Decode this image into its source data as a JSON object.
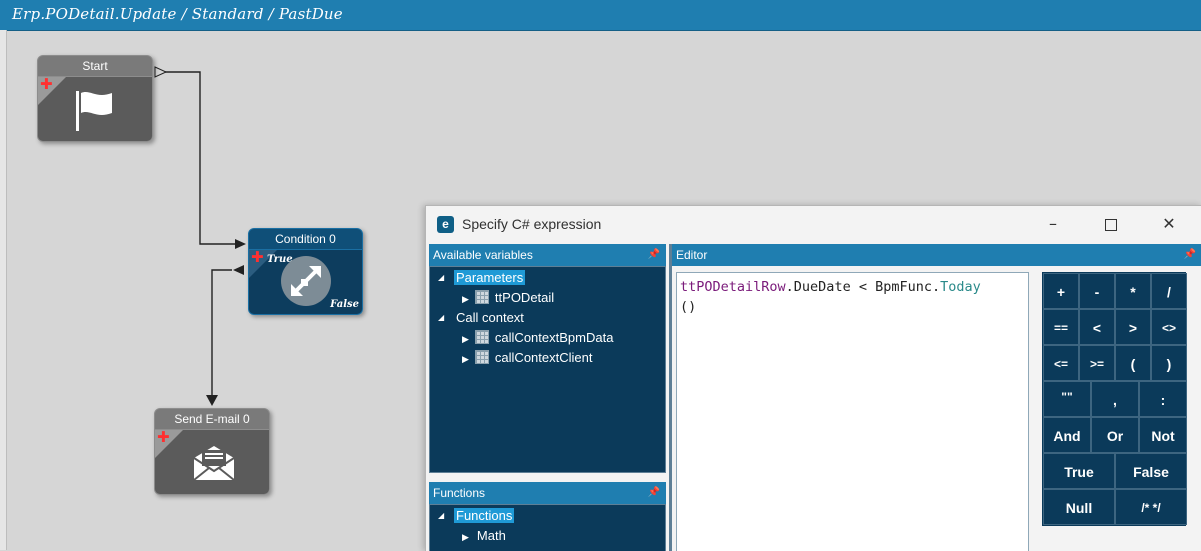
{
  "header": {
    "title": "Erp.PODetail.Update / Standard / PastDue"
  },
  "nodes": {
    "start": {
      "label": "Start",
      "icon": "flag-icon"
    },
    "condition": {
      "label": "Condition 0",
      "true_label": "True",
      "false_label": "False",
      "icon": "branch-arrows-icon"
    },
    "send_email": {
      "label": "Send E-mail 0",
      "icon": "envelope-icon"
    }
  },
  "dialog": {
    "title": "Specify C# expression",
    "controls": {
      "minimize": "–",
      "close": "✕"
    },
    "available_variables": {
      "header": "Available variables",
      "tree": [
        {
          "label": "Parameters",
          "expanded": true,
          "selected": true,
          "children": [
            "ttPODetail"
          ]
        },
        {
          "label": "Call context",
          "expanded": true,
          "children": [
            "callContextBpmData",
            "callContextClient"
          ]
        }
      ]
    },
    "functions": {
      "header": "Functions",
      "tree": [
        {
          "label": "Functions",
          "expanded": true,
          "selected": true,
          "children": [
            "Math"
          ]
        }
      ]
    },
    "editor": {
      "header": "Editor",
      "code": {
        "variable": "ttPODetailRow",
        "member": ".DueDate < BpmFunc.",
        "method": "Today",
        "call": "()"
      }
    },
    "operators": [
      [
        "+",
        "-",
        "*",
        "/"
      ],
      [
        "==",
        "<",
        ">",
        "<>"
      ],
      [
        "<=",
        ">=",
        "(",
        ")"
      ],
      [
        "\"\"",
        ",",
        ":"
      ],
      [
        "And",
        "Or",
        "Not"
      ],
      [
        "True",
        "False"
      ],
      [
        "Null",
        "/* */"
      ]
    ],
    "colors": {
      "accent": "#1f7eb0",
      "pane_bg": "#0b3a5a",
      "selection": "#1f9ad6"
    }
  }
}
